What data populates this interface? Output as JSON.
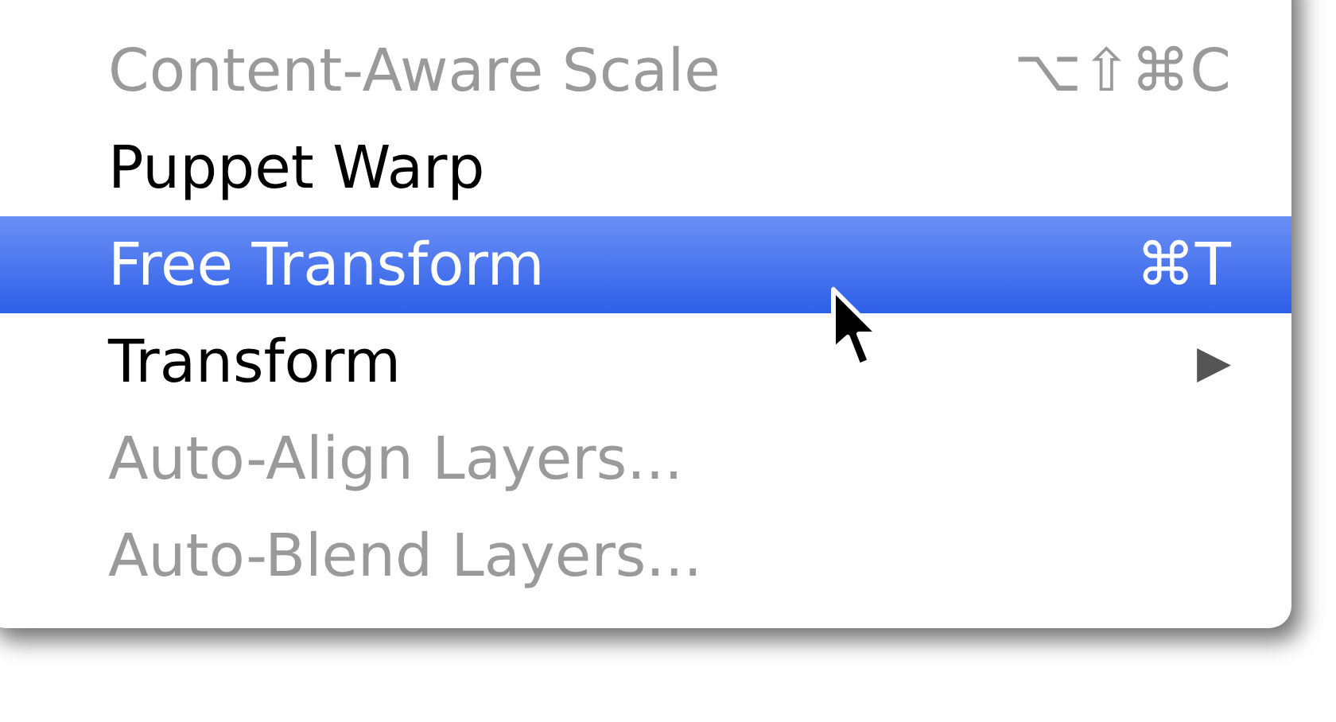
{
  "menu": {
    "items": [
      {
        "kind": "command",
        "label": "Content-Aware Scale",
        "shortcut": "⌥⇧⌘C",
        "disabled": true,
        "selected": false
      },
      {
        "kind": "command",
        "label": "Puppet Warp",
        "disabled": false,
        "selected": false
      },
      {
        "kind": "command",
        "label": "Free Transform",
        "shortcut": "⌘T",
        "disabled": false,
        "selected": true
      },
      {
        "kind": "submenu",
        "label": "Transform",
        "arrow": "▶",
        "disabled": false,
        "selected": false
      },
      {
        "kind": "command",
        "label": "Auto-Align Layers...",
        "disabled": true,
        "selected": false
      },
      {
        "kind": "command",
        "label": "Auto-Blend Layers...",
        "disabled": true,
        "selected": false
      }
    ]
  }
}
